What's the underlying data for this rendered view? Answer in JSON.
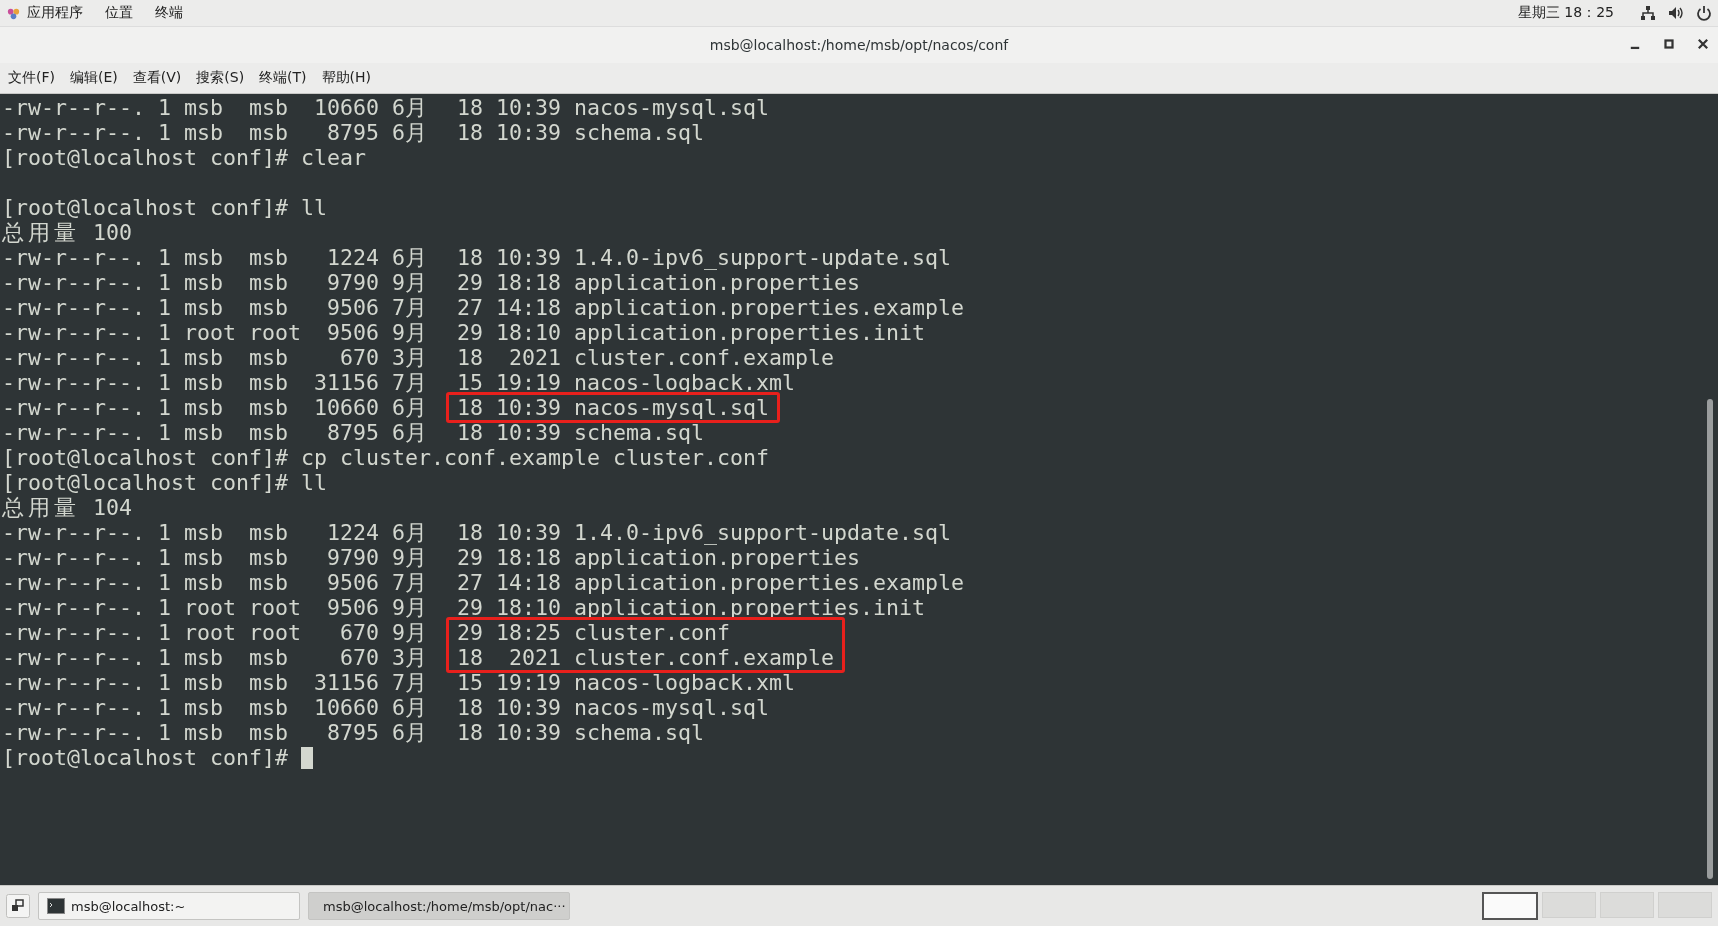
{
  "top_bar": {
    "menus": [
      "应用程序",
      "位置",
      "终端"
    ],
    "clock": "星期三 18：25"
  },
  "window": {
    "title": "msb@localhost:/home/msb/opt/nacos/conf"
  },
  "menu_bar": [
    "文件(F)",
    "编辑(E)",
    "查看(V)",
    "搜索(S)",
    "终端(T)",
    "帮助(H)"
  ],
  "terminal": {
    "lines": [
      {
        "kind": "output",
        "text": "-rw-r--r--. 1 msb  msb  10660 6月  18 10:39 nacos-mysql.sql"
      },
      {
        "kind": "output",
        "text": "-rw-r--r--. 1 msb  msb   8795 6月  18 10:39 schema.sql"
      },
      {
        "kind": "output",
        "text": "[root@localhost conf]# clear"
      },
      {
        "kind": "blank"
      },
      {
        "kind": "output",
        "text": "[root@localhost conf]# ll"
      },
      {
        "kind": "output",
        "text": "总用量 100"
      },
      {
        "kind": "output",
        "text": "-rw-r--r--. 1 msb  msb   1224 6月  18 10:39 1.4.0-ipv6_support-update.sql"
      },
      {
        "kind": "output",
        "text": "-rw-r--r--. 1 msb  msb   9790 9月  29 18:18 application.properties"
      },
      {
        "kind": "output",
        "text": "-rw-r--r--. 1 msb  msb   9506 7月  27 14:18 application.properties.example"
      },
      {
        "kind": "output",
        "text": "-rw-r--r--. 1 root root  9506 9月  29 18:10 application.properties.init"
      },
      {
        "kind": "output",
        "text": "-rw-r--r--. 1 msb  msb    670 3月  18  2021 cluster.conf.example"
      },
      {
        "kind": "output",
        "text": "-rw-r--r--. 1 msb  msb  31156 7月  15 19:19 nacos-logback.xml"
      },
      {
        "kind": "highlight",
        "lines": [
          {
            "prefix": "-rw-r--r--. 1 msb  msb  10660 6月  ",
            "marked": "18 10:39 nacos-mysql.sql"
          }
        ]
      },
      {
        "kind": "output",
        "text": "-rw-r--r--. 1 msb  msb   8795 6月  18 10:39 schema.sql"
      },
      {
        "kind": "output",
        "text": "[root@localhost conf]# cp cluster.conf.example cluster.conf"
      },
      {
        "kind": "output",
        "text": "[root@localhost conf]# ll"
      },
      {
        "kind": "output",
        "text": "总用量 104"
      },
      {
        "kind": "output",
        "text": "-rw-r--r--. 1 msb  msb   1224 6月  18 10:39 1.4.0-ipv6_support-update.sql"
      },
      {
        "kind": "output",
        "text": "-rw-r--r--. 1 msb  msb   9790 9月  29 18:18 application.properties"
      },
      {
        "kind": "output",
        "text": "-rw-r--r--. 1 msb  msb   9506 7月  27 14:18 application.properties.example"
      },
      {
        "kind": "output",
        "text": "-rw-r--r--. 1 root root  9506 9月  29 18:10 application.properties.init"
      },
      {
        "kind": "highlight",
        "lines": [
          {
            "prefix": "-rw-r--r--. 1 root root   670 9月  ",
            "marked": "29 18:25 cluster.conf"
          },
          {
            "prefix": "-rw-r--r--. 1 msb  msb    670 3月  ",
            "marked": "18  2021 cluster.conf.example"
          }
        ]
      },
      {
        "kind": "output",
        "text": "-rw-r--r--. 1 msb  msb  31156 7月  15 19:19 nacos-logback.xml"
      },
      {
        "kind": "output",
        "text": "-rw-r--r--. 1 msb  msb  10660 6月  18 10:39 nacos-mysql.sql"
      },
      {
        "kind": "output",
        "text": "-rw-r--r--. 1 msb  msb   8795 6月  18 10:39 schema.sql"
      },
      {
        "kind": "prompt",
        "text": "[root@localhost conf]# ",
        "cursor": true
      }
    ]
  },
  "taskbar": {
    "windows": [
      {
        "label": "msb@localhost:~",
        "selected": false
      },
      {
        "label": "msb@localhost:/home/msb/opt/nac···",
        "selected": true
      }
    ],
    "workspaces": [
      {
        "selected": true
      },
      {
        "selected": false
      },
      {
        "selected": false
      },
      {
        "selected": false
      }
    ]
  }
}
